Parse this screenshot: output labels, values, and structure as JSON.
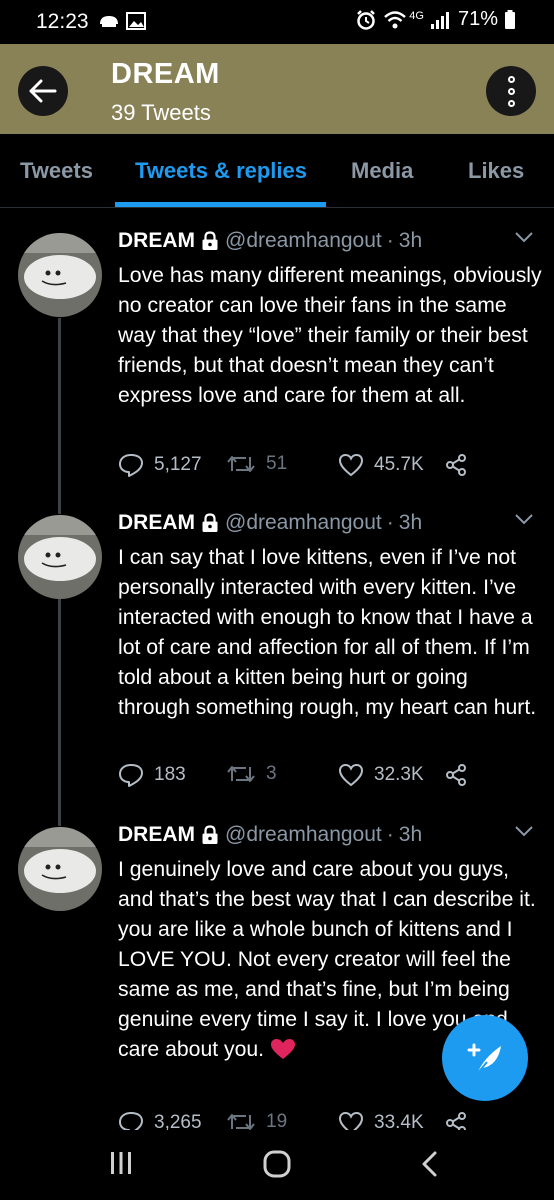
{
  "status_bar": {
    "time": "12:23",
    "network": "4G",
    "battery": "71%"
  },
  "header": {
    "title": "DREAM",
    "subtitle": "39 Tweets"
  },
  "tabs": [
    {
      "label": "Tweets",
      "active": false
    },
    {
      "label": "Tweets & replies",
      "active": true
    },
    {
      "label": "Media",
      "active": false
    },
    {
      "label": "Likes",
      "active": false
    }
  ],
  "tweets": [
    {
      "name": "DREAM",
      "handle": "@dreamhangout",
      "separator": "·",
      "time": "3h",
      "text": "Love has many different meanings, obviously no creator can love their fans in the same way that they “love” their family or their best friends, but that doesn’t mean they can’t express love and care for them at all.",
      "replies": "5,127",
      "retweets": "51",
      "likes": "45.7K"
    },
    {
      "name": "DREAM",
      "handle": "@dreamhangout",
      "separator": "·",
      "time": "3h",
      "text": "I can say that I love kittens, even if I’ve not personally interacted with every kitten. I’ve interacted with enough to know that I have a lot of care and affection for all of them. If I’m told about a kitten being hurt or going through something rough, my heart can hurt.",
      "replies": "183",
      "retweets": "3",
      "likes": "32.3K"
    },
    {
      "name": "DREAM",
      "handle": "@dreamhangout",
      "separator": "·",
      "time": "3h",
      "text": "I genuinely love and care about you guys, and that’s the best way that I can describe it. you are like a whole bunch of kittens and I LOVE YOU. Not every creator will feel the same as me, and that’s fine, but I’m being genuine every time I say it. I love you and care about you.",
      "replies": "3,265",
      "retweets": "19",
      "likes": "33.4K"
    }
  ],
  "colors": {
    "header_bg": "#8a8257",
    "accent": "#1d9bf0",
    "muted": "#8b98a5",
    "heart": "#e0245e"
  },
  "icons": {
    "back": "arrow-left-icon",
    "more": "vertical-dots-icon",
    "lock": "lock-icon",
    "reply": "reply-icon",
    "retweet": "retweet-icon",
    "like": "heart-icon",
    "share": "share-icon",
    "compose": "compose-feather-icon",
    "nav_recents": "recents-icon",
    "nav_home": "home-icon",
    "nav_back": "back-icon"
  }
}
